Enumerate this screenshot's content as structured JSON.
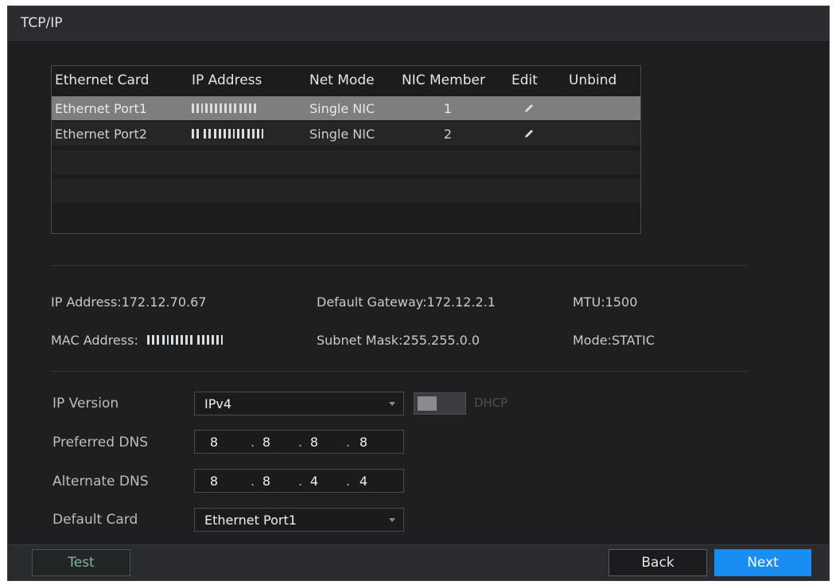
{
  "window": {
    "title": "TCP/IP"
  },
  "table": {
    "columns": [
      "Ethernet Card",
      "IP Address",
      "Net Mode",
      "NIC Member",
      "Edit",
      "Unbind"
    ],
    "rows": [
      {
        "card": "Ethernet Port1",
        "net_mode": "Single NIC",
        "nic_member": "1",
        "edit_icon": "pencil-icon"
      },
      {
        "card": "Ethernet Port2",
        "net_mode": "Single NIC",
        "nic_member": "2",
        "edit_icon": "pencil-icon"
      }
    ]
  },
  "info": {
    "ip_address_label": "IP Address:",
    "ip_address_value": "172.12.70.67",
    "default_gateway_label": "Default Gateway:",
    "default_gateway_value": "172.12.2.1",
    "mtu_label": "MTU:",
    "mtu_value": "1500",
    "mac_address_label": "MAC Address:",
    "subnet_mask_label": "Subnet Mask:",
    "subnet_mask_value": "255.255.0.0",
    "mode_label": "Mode:",
    "mode_value": "STATIC"
  },
  "form": {
    "ip_version_label": "IP Version",
    "ip_version_value": "IPv4",
    "dhcp_label": "DHCP",
    "preferred_dns_label": "Preferred DNS",
    "preferred_dns": [
      "8",
      "8",
      "8",
      "8"
    ],
    "alternate_dns_label": "Alternate DNS",
    "alternate_dns": [
      "8",
      "8",
      "4",
      "4"
    ],
    "ip_separator": ".",
    "default_card_label": "Default Card",
    "default_card_value": "Ethernet Port1"
  },
  "footer": {
    "test_label": "Test",
    "back_label": "Back",
    "next_label": "Next"
  },
  "colors": {
    "accent": "#1a8df2",
    "background": "#1e1f21",
    "selected_row": "#7d7e80"
  }
}
